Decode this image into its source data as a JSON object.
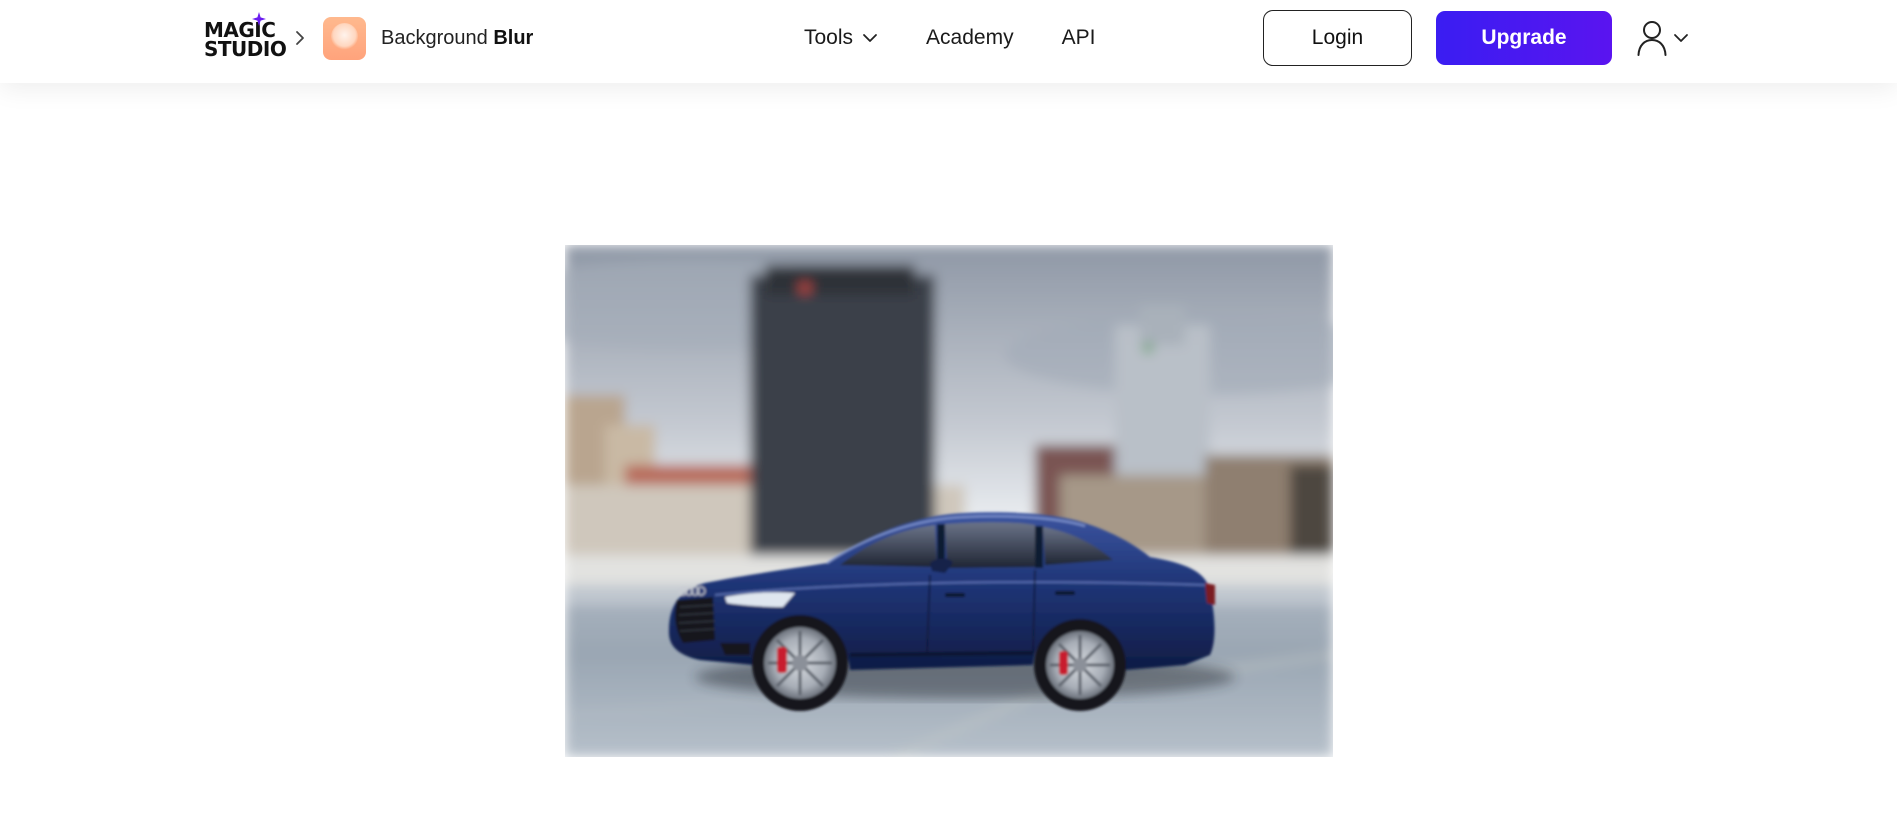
{
  "header": {
    "logo": {
      "line1": "MAGIC",
      "line2": "STUDIO"
    },
    "breadcrumb": {
      "app_name_regular": "Background",
      "app_name_bold": "Blur"
    },
    "nav": {
      "tools": "Tools",
      "academy": "Academy",
      "api": "API"
    },
    "login_label": "Login",
    "upgrade_label": "Upgrade"
  },
  "icons": {
    "logo_spark": "sparkle-icon",
    "breadcrumb_separator": "chevron-right-icon",
    "app": "background-blur-app-icon",
    "tools_dropdown": "chevron-down-icon",
    "account": "user-icon",
    "account_dropdown": "chevron-down-icon"
  },
  "colors": {
    "accent": "#4a18f1",
    "app_icon": "#ffab82",
    "car": "#1c2f6e"
  }
}
